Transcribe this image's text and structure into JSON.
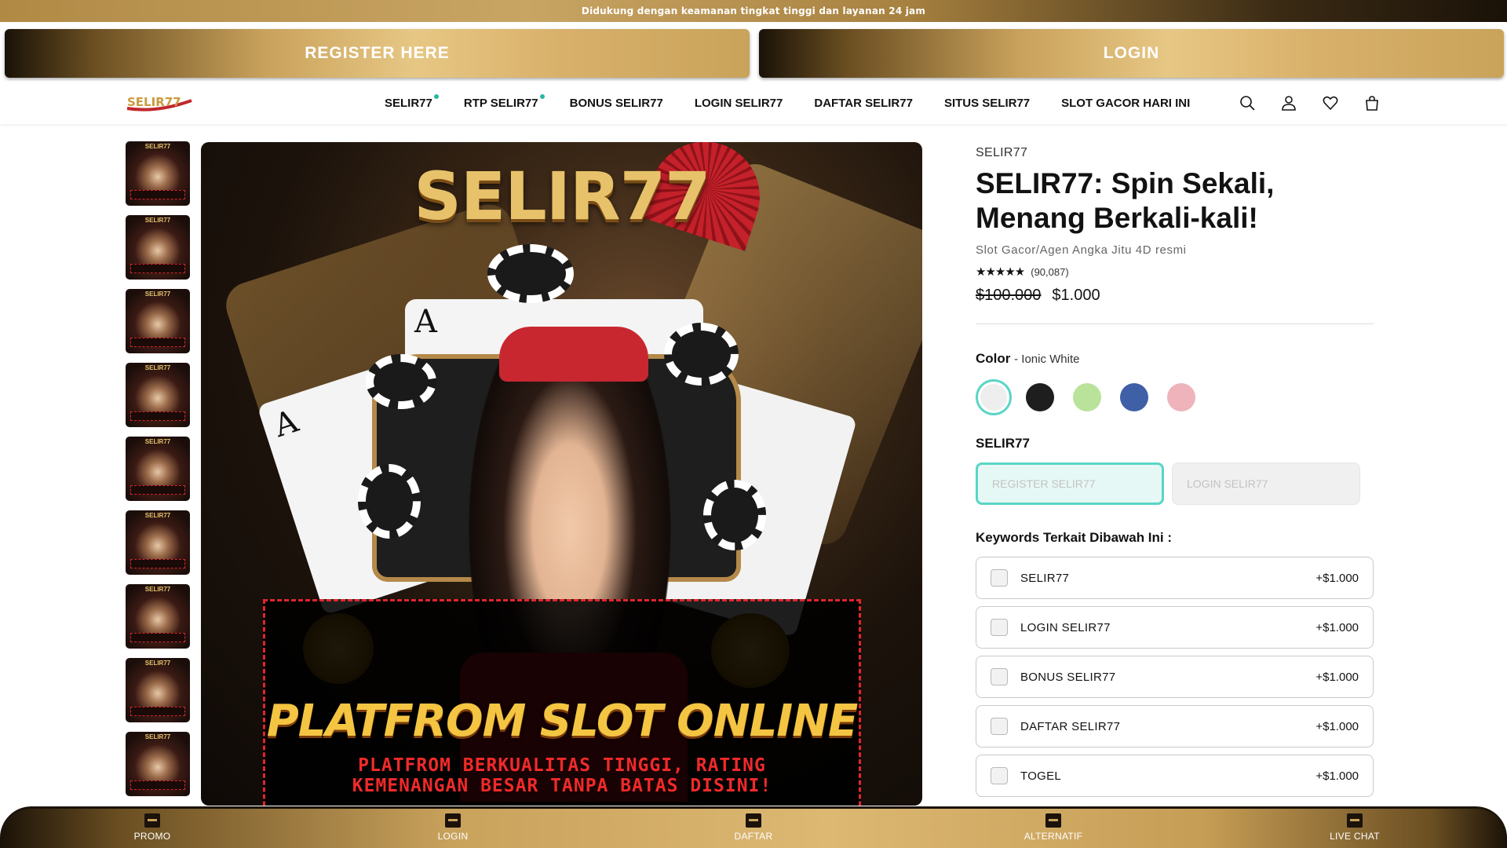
{
  "announcement": "Didukung dengan keamanan tingkat tinggi dan layanan 24 jam",
  "cta": {
    "register": "REGISTER HERE",
    "login": "LOGIN"
  },
  "nav": {
    "logo": "SELIR77",
    "links": [
      "SELIR77",
      "RTP SELIR77",
      "BONUS SELIR77",
      "LOGIN SELIR77",
      "DAFTAR SELIR77",
      "SITUS SELIR77",
      "SLOT GACOR HARI INI"
    ],
    "icons": [
      "search-icon",
      "account-icon",
      "heart-icon",
      "cart-icon"
    ]
  },
  "thumbnails": {
    "count": 9,
    "label": "SELIR77"
  },
  "hero": {
    "logo_text": "SELIR77",
    "card_rank": "A",
    "banner_title": "PLATFROM SLOT ONLINE",
    "banner_sub_1": "PLATFROM BERKUALITAS TINGGI, RATING",
    "banner_sub_2": "KEMENANGAN BESAR TANPA BATAS DISINI!"
  },
  "product": {
    "vendor": "SELIR77",
    "title": "SELIR77: Spin Sekali, Menang Berkali-kali!",
    "subtitle": "Slot Gacor/Agen Angka Jitu 4D resmi",
    "stars": "★★★★★",
    "rating_count": "(90,087)",
    "price_old": "$100.000",
    "price_new": "$1.000",
    "color_label": "Color",
    "color_value": "- Ionic White",
    "colors": [
      "#eeeeee",
      "#1e1e1e",
      "#b9e39a",
      "#3f5fa7",
      "#eeb3bb"
    ],
    "option_label": "SELIR77",
    "options": [
      "REGISTER SELIR77",
      "LOGIN SELIR77"
    ],
    "keywords_label": "Keywords Terkait Dibawah Ini :",
    "keywords": [
      {
        "name": "SELIR77",
        "price": "+$1.000"
      },
      {
        "name": "LOGIN SELIR77",
        "price": "+$1.000"
      },
      {
        "name": "BONUS SELIR77",
        "price": "+$1.000"
      },
      {
        "name": "DAFTAR SELIR77",
        "price": "+$1.000"
      },
      {
        "name": "TOGEL",
        "price": "+$1.000"
      }
    ]
  },
  "bottom_nav": [
    "PROMO",
    "LOGIN",
    "DAFTAR",
    "ALTERNATIF",
    "LIVE CHAT"
  ],
  "colors": {
    "accent": "#5ad5c6",
    "gold": "#c9a25c",
    "dark": "#1a1208"
  }
}
